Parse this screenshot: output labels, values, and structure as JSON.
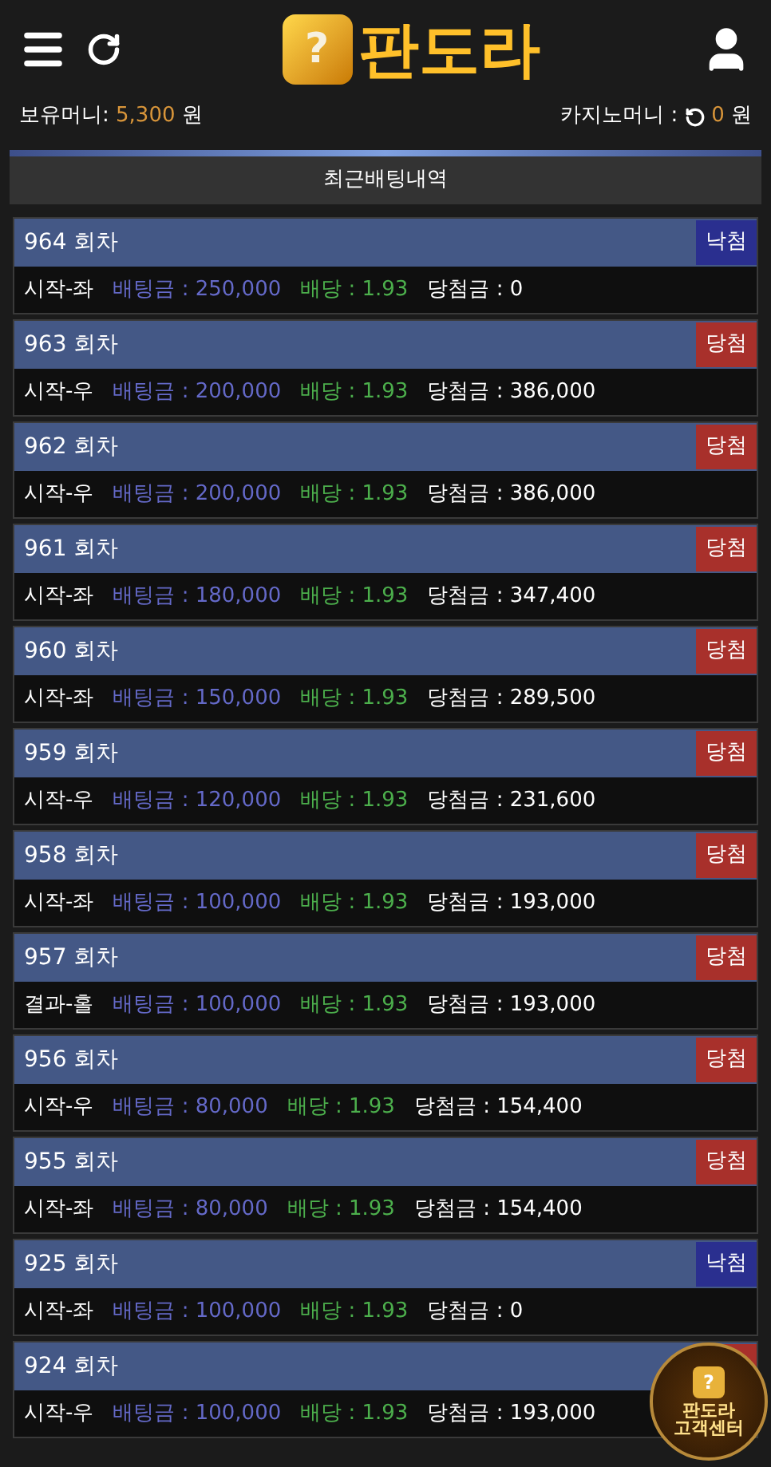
{
  "header": {
    "logo_mark": "?",
    "logo_text": "판도라"
  },
  "balance": {
    "label": "보유머니:",
    "amount": "5,300",
    "unit": "원"
  },
  "casino": {
    "label": "카지노머니 :",
    "amount": "0",
    "unit": "원"
  },
  "section_title": "최근배팅내역",
  "bets": [
    {
      "round": "964 회차",
      "result": {
        "kind": "lose",
        "label": "낙첨"
      },
      "pick": "시작-좌",
      "stake": "배팅금 : 250,000",
      "odds": "배당 : 1.93",
      "payout": "당첨금 : 0"
    },
    {
      "round": "963 회차",
      "result": {
        "kind": "win",
        "label": "당첨"
      },
      "pick": "시작-우",
      "stake": "배팅금 : 200,000",
      "odds": "배당 : 1.93",
      "payout": "당첨금 : 386,000"
    },
    {
      "round": "962 회차",
      "result": {
        "kind": "win",
        "label": "당첨"
      },
      "pick": "시작-우",
      "stake": "배팅금 : 200,000",
      "odds": "배당 : 1.93",
      "payout": "당첨금 : 386,000"
    },
    {
      "round": "961 회차",
      "result": {
        "kind": "win",
        "label": "당첨"
      },
      "pick": "시작-좌",
      "stake": "배팅금 : 180,000",
      "odds": "배당 : 1.93",
      "payout": "당첨금 : 347,400"
    },
    {
      "round": "960 회차",
      "result": {
        "kind": "win",
        "label": "당첨"
      },
      "pick": "시작-좌",
      "stake": "배팅금 : 150,000",
      "odds": "배당 : 1.93",
      "payout": "당첨금 : 289,500"
    },
    {
      "round": "959 회차",
      "result": {
        "kind": "win",
        "label": "당첨"
      },
      "pick": "시작-우",
      "stake": "배팅금 : 120,000",
      "odds": "배당 : 1.93",
      "payout": "당첨금 : 231,600"
    },
    {
      "round": "958 회차",
      "result": {
        "kind": "win",
        "label": "당첨"
      },
      "pick": "시작-좌",
      "stake": "배팅금 : 100,000",
      "odds": "배당 : 1.93",
      "payout": "당첨금 : 193,000"
    },
    {
      "round": "957 회차",
      "result": {
        "kind": "win",
        "label": "당첨"
      },
      "pick": "결과-홀",
      "stake": "배팅금 : 100,000",
      "odds": "배당 : 1.93",
      "payout": "당첨금 : 193,000"
    },
    {
      "round": "956 회차",
      "result": {
        "kind": "win",
        "label": "당첨"
      },
      "pick": "시작-우",
      "stake": "배팅금 : 80,000",
      "odds": "배당 : 1.93",
      "payout": "당첨금 : 154,400"
    },
    {
      "round": "955 회차",
      "result": {
        "kind": "win",
        "label": "당첨"
      },
      "pick": "시작-좌",
      "stake": "배팅금 : 80,000",
      "odds": "배당 : 1.93",
      "payout": "당첨금 : 154,400"
    },
    {
      "round": "925 회차",
      "result": {
        "kind": "lose",
        "label": "낙첨"
      },
      "pick": "시작-좌",
      "stake": "배팅금 : 100,000",
      "odds": "배당 : 1.93",
      "payout": "당첨금 : 0"
    },
    {
      "round": "924 회차",
      "result": {
        "kind": "win"
      },
      "pick": "시작-우",
      "stake": "배팅금 : 100,000",
      "odds": "배당 : 1.93",
      "payout": "당첨금 : 193,000"
    }
  ],
  "support_badge": {
    "mark": "?",
    "line_1": "판도라",
    "line_2": "고객센터"
  }
}
